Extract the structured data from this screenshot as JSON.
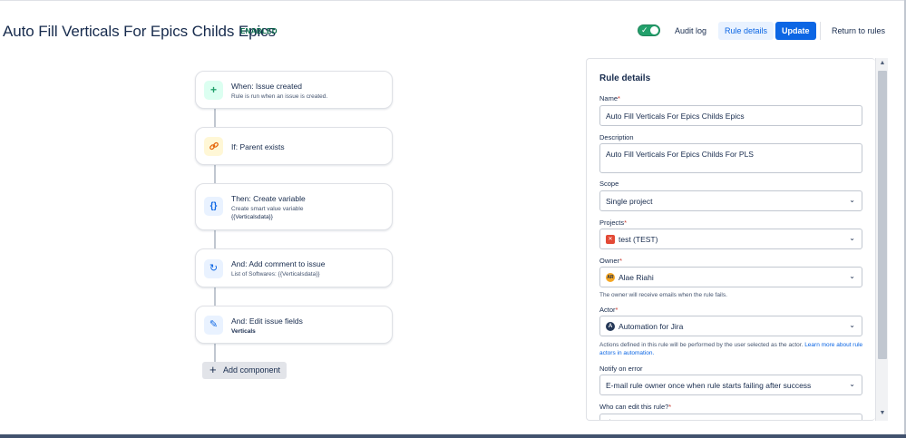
{
  "header": {
    "title": "Auto Fill Verticals For Epics Childs Epics",
    "status": "ENABLED",
    "audit_log_label": "Audit log",
    "rule_details_label": "Rule details",
    "update_label": "Update",
    "return_label": "Return to rules",
    "toggle_on": true
  },
  "flow": {
    "components": [
      {
        "title": "When: Issue created",
        "description": "Rule is run when an issue is created.",
        "icon": "plus-icon",
        "color": "#22a06b"
      },
      {
        "title": "If: Parent exists",
        "icon": "link-icon",
        "color": "#f5a623"
      },
      {
        "title": "Then: Create variable",
        "description": "Create smart value variable",
        "detail": "{{Verticalsdata}}",
        "icon": "braces-icon",
        "color": "#0c66e4"
      },
      {
        "title": "And: Add comment to issue",
        "description": "List of Softwares: {{Verticalsdata}}",
        "icon": "refresh-icon",
        "color": "#0c66e4"
      },
      {
        "title": "And: Edit issue fields",
        "detail": "Verticals",
        "icon": "pencil-icon",
        "color": "#0c66e4"
      }
    ],
    "add_component_label": "Add component"
  },
  "panel": {
    "title": "Rule details",
    "name": {
      "label": "Name",
      "value": "Auto Fill Verticals For Epics Childs Epics"
    },
    "description": {
      "label": "Description",
      "value": "Auto Fill Verticals For Epics Childs For PLS"
    },
    "scope": {
      "label": "Scope",
      "value": "Single project"
    },
    "projects": {
      "label": "Projects",
      "value": "test (TEST)"
    },
    "owner": {
      "label": "Owner",
      "value": "Alae Riahi",
      "initials": "AR",
      "help": "The owner will receive emails when the rule fails."
    },
    "actor": {
      "label": "Actor",
      "value": "Automation for Jira",
      "help": "Actions defined in this rule will be performed by the user selected as the actor.",
      "help_link": "Learn more about rule actors in automation."
    },
    "notify": {
      "label": "Notify on error",
      "value": "E-mail rule owner once when rule starts failing after success"
    },
    "who_can_edit": {
      "label": "Who can edit this rule?"
    }
  }
}
